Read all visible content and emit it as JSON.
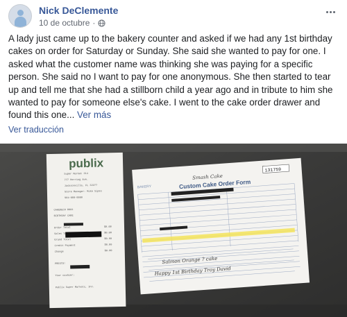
{
  "post": {
    "author": "Nick DeClemente",
    "date": "10 de octubre",
    "dot": "·",
    "text_main": "A lady just came up to the bakery counter and asked if we had any 1st birthday cakes on order for Saturday or Sunday. She said she wanted to pay for one. I asked what the customer name was thinking she was paying for a specific person. She said no I want to pay for one anonymous. She then started to tear up and tell me that she had a stillborn child a year ago and in tribute to him she wanted to pay for someone else's cake. I went to the cake order drawer and found this one...",
    "see_more": "Ver más",
    "translate": "Ver traducción",
    "icons": {
      "privacy": "globe-icon",
      "options": "more-options-icon",
      "avatar": "avatar-icon"
    }
  },
  "receipt": {
    "brand": "publix",
    "lines": [
      "Super Market 214",
      "777 Herring Ave.",
      "Jacksonville, FL 32277",
      "Store Manager: Mike Sipes",
      "904-000-0000",
      "",
      "CAKEDECO 0001",
      "BIRTHDAY CAKE",
      "",
      "Order Total",
      "Sales Tax",
      "Grand Total",
      "Credit Payment",
      "Change",
      "",
      "PRESTO!",
      "",
      "Your cashier:",
      "",
      "Publix Super Markets, Inc."
    ],
    "amounts": [
      "$0.00",
      "$0.00",
      "$0.00",
      "$0.00",
      "$0.00"
    ]
  },
  "order_form": {
    "bakery_label": "BAKERY",
    "title": "Custom Cake Order Form",
    "order_number": "131759",
    "handwritten_top": "Smash Cake",
    "handwritten_1": "Salmon   Orange   ?   cake",
    "handwritten_2": "Happy 1st Birthday  Troy David",
    "colors": {
      "highlight": "#f3e35a",
      "form_ink": "#7a8fb0",
      "photo_bg": "#3b3b3a"
    }
  }
}
